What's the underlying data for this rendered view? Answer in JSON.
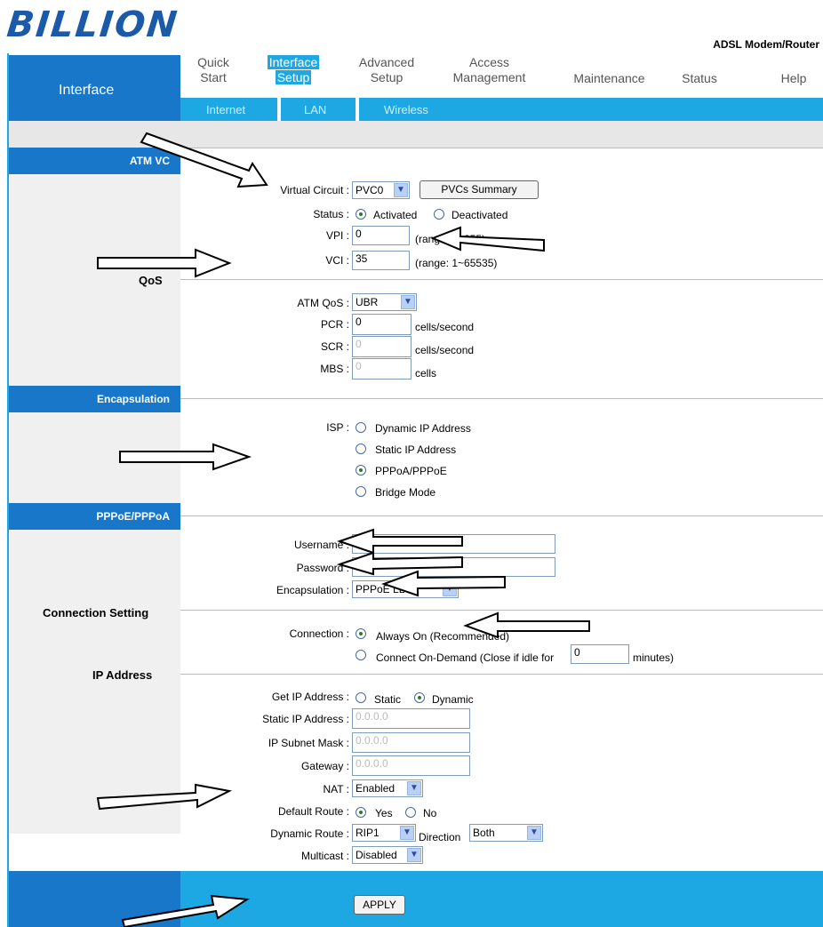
{
  "brand": {
    "logo": "BILLION",
    "product": "ADSL Modem/Router"
  },
  "header": {
    "section_title": "Interface",
    "menu": [
      {
        "line1": "Quick",
        "line2": "Start"
      },
      {
        "line1": "Interface",
        "line2": "Setup"
      },
      {
        "line1": "Advanced",
        "line2": "Setup"
      },
      {
        "line1": "Access",
        "line2": "Management"
      },
      {
        "line1": "Maintenance",
        "line2": ""
      },
      {
        "line1": "Status",
        "line2": ""
      },
      {
        "line1": "Help",
        "line2": ""
      }
    ],
    "submenu": [
      "Internet",
      "LAN",
      "Wireless"
    ]
  },
  "atm_vc": {
    "section": "ATM VC",
    "virtual_circuit_label": "Virtual Circuit :",
    "virtual_circuit_value": "PVC0",
    "pvcs_summary_button": "PVCs Summary",
    "status_label": "Status :",
    "status_options": [
      "Activated",
      "Deactivated"
    ],
    "vpi_label": "VPI :",
    "vpi_value": "0",
    "vpi_range": "(range: 0~255)",
    "vci_label": "VCI :",
    "vci_value": "35",
    "vci_range": "(range: 1~65535)"
  },
  "qos": {
    "section": "QoS",
    "atm_qos_label": "ATM QoS :",
    "atm_qos_value": "UBR",
    "pcr_label": "PCR :",
    "pcr_value": "0",
    "pcr_unit": "cells/second",
    "scr_label": "SCR :",
    "scr_value": "0",
    "scr_unit": "cells/second",
    "mbs_label": "MBS :",
    "mbs_value": "0",
    "mbs_unit": "cells"
  },
  "encapsulation": {
    "section": "Encapsulation",
    "isp_label": "ISP :",
    "isp_options": [
      "Dynamic IP Address",
      "Static IP Address",
      "PPPoA/PPPoE",
      "Bridge Mode"
    ]
  },
  "pppoe": {
    "section": "PPPoE/PPPoA",
    "username_label": "Username :",
    "password_label": "Password :",
    "encapsulation_label": "Encapsulation :",
    "encapsulation_value": "PPPoE LLC"
  },
  "connection": {
    "section": "Connection Setting",
    "connection_label": "Connection :",
    "always_on": "Always On (Recommended)",
    "on_demand": "Connect On-Demand (Close if idle for",
    "idle_value": "0",
    "idle_unit": "minutes)"
  },
  "ip": {
    "section": "IP Address",
    "get_ip_label": "Get IP Address :",
    "get_ip_options": [
      "Static",
      "Dynamic"
    ],
    "static_ip_label": "Static IP Address :",
    "static_ip_value": "0.0.0.0",
    "subnet_label": "IP Subnet Mask :",
    "subnet_value": "0.0.0.0",
    "gateway_label": "Gateway :",
    "gateway_value": "0.0.0.0",
    "nat_label": "NAT :",
    "nat_value": "Enabled",
    "default_route_label": "Default Route :",
    "default_route_options": [
      "Yes",
      "No"
    ],
    "dynamic_route_label": "Dynamic Route :",
    "dynamic_route_value": "RIP1",
    "direction_label": "Direction",
    "direction_value": "Both",
    "multicast_label": "Multicast :",
    "multicast_value": "Disabled"
  },
  "footer": {
    "apply_button": "APPLY"
  }
}
